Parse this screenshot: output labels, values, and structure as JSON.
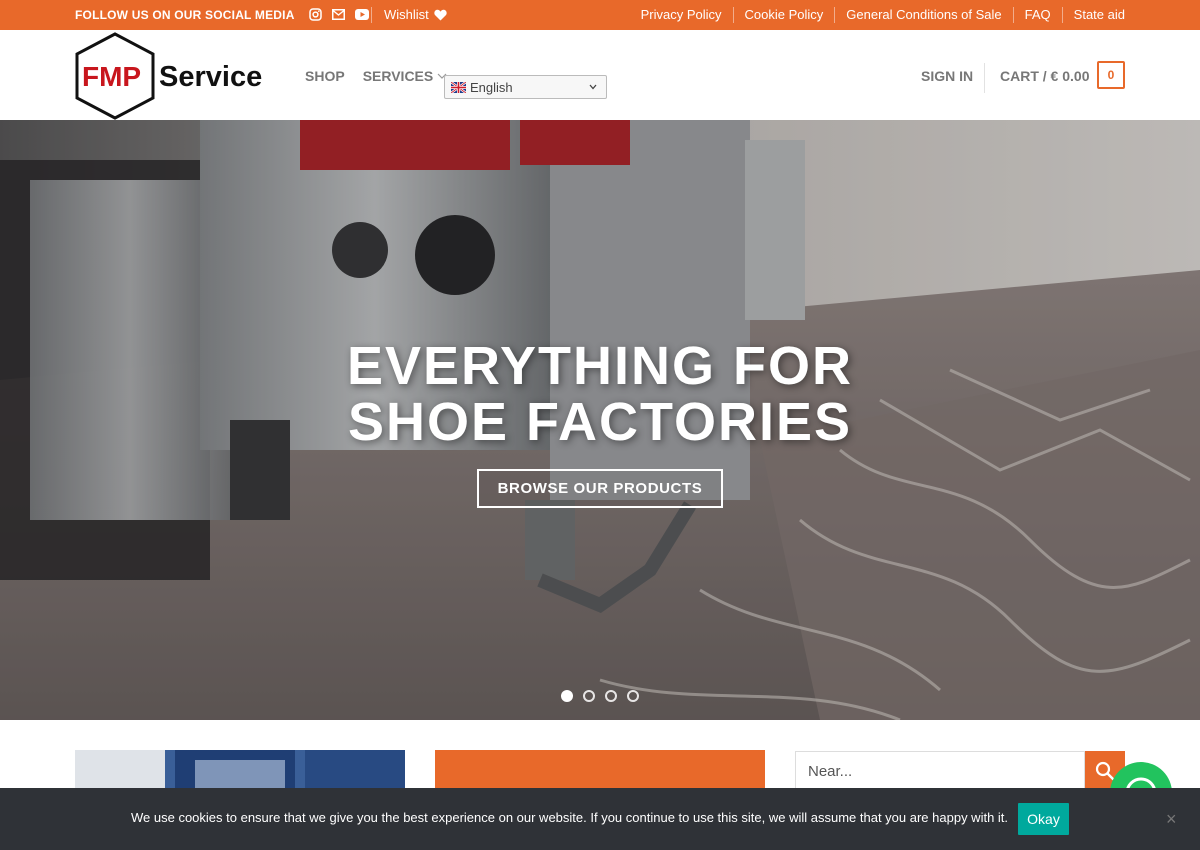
{
  "topbar": {
    "social_label": "FOLLOW US ON OUR SOCIAL MEDIA",
    "social_icons": [
      "instagram-icon",
      "envelope-icon",
      "youtube-icon"
    ],
    "wishlist_label": "Wishlist",
    "links": [
      "Privacy Policy",
      "Cookie Policy",
      "General Conditions of Sale",
      "FAQ",
      "State aid"
    ]
  },
  "header": {
    "logo_fmp": "FMP",
    "logo_service": "Service",
    "nav": {
      "shop": "SHOP",
      "services": "SERVICES"
    },
    "language": "English",
    "signin": "SIGN IN",
    "cart_label": "CART / € 0.00",
    "cart_count": "0"
  },
  "hero": {
    "title_line1": "EVERYTHING FOR",
    "title_line2": "SHOE FACTORIES",
    "button": "BROWSE OUR PRODUCTS",
    "slides_total": 4,
    "active_slide": 1
  },
  "search": {
    "placeholder": "Near..."
  },
  "cookie": {
    "message": "We use cookies to ensure that we give you the best experience on our website. If you continue to use this site, we will assume that you are happy with it.",
    "ok_label": "Okay",
    "close_label": "×"
  },
  "colors": {
    "accent": "#e8692a",
    "cookie_bg": "#2f3237",
    "ok_button": "#00a99d",
    "whatsapp": "#22c35e"
  }
}
